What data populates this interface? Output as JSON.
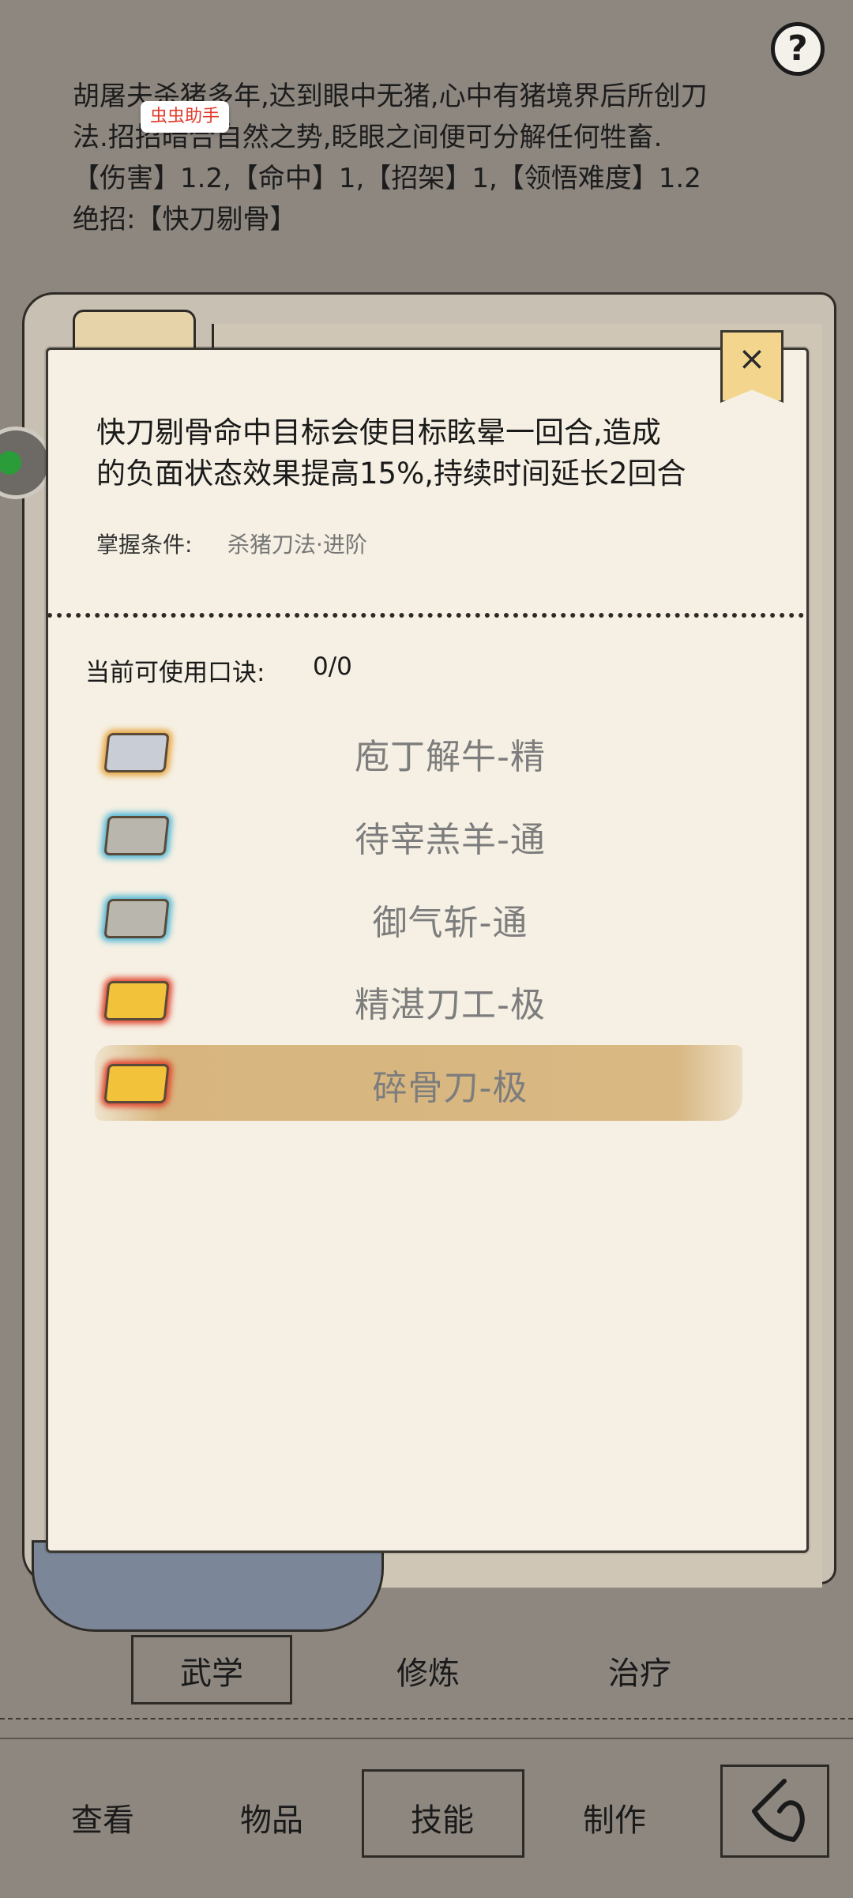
{
  "skill_description": {
    "lines": [
      "胡屠夫杀猪多年,达到眼中无猪,心中有猪境界后所创刀",
      "法.招招暗合自然之势,眨眼之间便可分解任何牲畜.",
      "【伤害】1.2,【命中】1,【招架】1,【领悟难度】1.2",
      "绝招:【快刀剔骨】"
    ]
  },
  "helper_badge": "虫虫助手",
  "help_icon": "?",
  "popup": {
    "close_icon": "×",
    "effect_lines": [
      "快刀剔骨命中目标会使目标眩晕一回合,造成",
      "的负面状态效果提高15%,持续时间延长2回合"
    ],
    "condition_label": "掌握条件:",
    "condition_value": "杀猪刀法·进阶",
    "usable_label": "当前可使用口诀:",
    "usable_value": "0/0",
    "skills": [
      {
        "name": "庖丁解牛-精",
        "chip_color": "#c9ced6",
        "glow": "#e8a23a"
      },
      {
        "name": "待宰羔羊-通",
        "chip_color": "#b9b6ad",
        "glow": "#4fb6d6"
      },
      {
        "name": "御气斩-通",
        "chip_color": "#b9b6ad",
        "glow": "#4fb6d6"
      },
      {
        "name": "精湛刀工-极",
        "chip_color": "#f2c23a",
        "glow": "#e0402a"
      },
      {
        "name": "碎骨刀-极",
        "chip_color": "#f2c23a",
        "glow": "#e0402a",
        "selected": true
      }
    ]
  },
  "tabs": [
    "武学",
    "修炼",
    "治疗"
  ],
  "nav": [
    "查看",
    "物品",
    "技能",
    "制作"
  ]
}
